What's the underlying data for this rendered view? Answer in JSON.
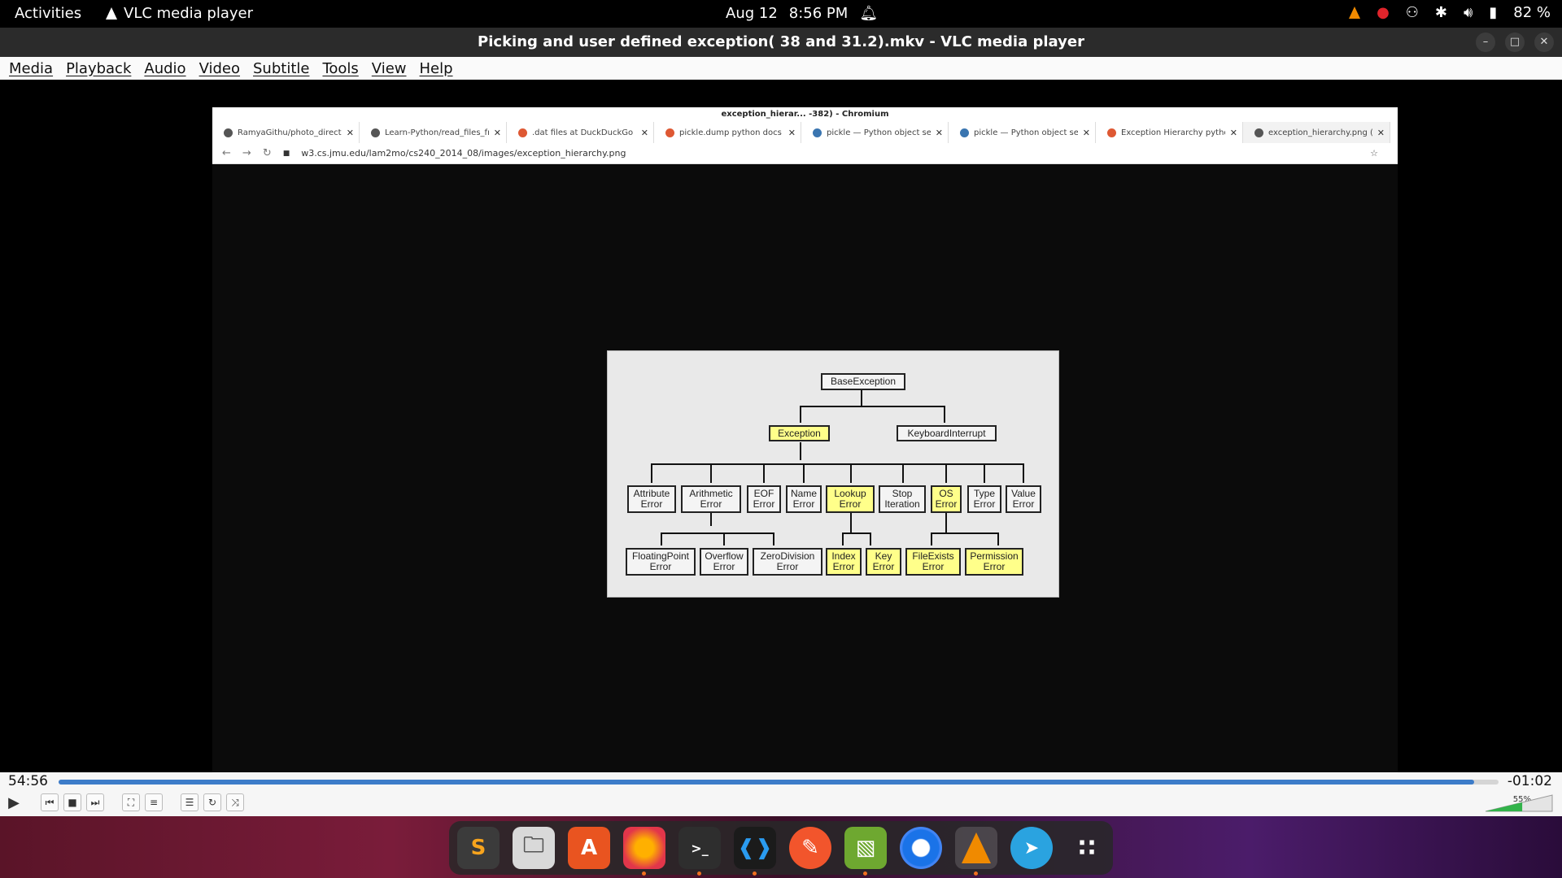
{
  "topbar": {
    "activities": "Activities",
    "app_name": "VLC media player",
    "date": "Aug 12",
    "time": "8:56 PM",
    "battery": "82 %"
  },
  "window": {
    "title": "Picking and user defined exception( 38 and 31.2).mkv - VLC media player"
  },
  "menu": [
    "Media",
    "Playback",
    "Audio",
    "Video",
    "Subtitle",
    "Tools",
    "View",
    "Help"
  ],
  "browser": {
    "window_title": "exception_hierar... -382) - Chromium",
    "tabs": [
      {
        "title": "RamyaGithu/photo_directo",
        "icon": "github-icon"
      },
      {
        "title": "Learn-Python/read_files_fr",
        "icon": "github-icon"
      },
      {
        "title": ".dat files at DuckDuckGo",
        "icon": "duckduckgo-icon"
      },
      {
        "title": "pickle.dump python docs at",
        "icon": "duckduckgo-icon"
      },
      {
        "title": "pickle — Python object seri",
        "icon": "python-icon"
      },
      {
        "title": "pickle — Python object seri",
        "icon": "python-icon"
      },
      {
        "title": "Exception Hierarchy python",
        "icon": "duckduckgo-icon"
      },
      {
        "title": "exception_hierarchy.png (7",
        "icon": "globe-icon"
      }
    ],
    "url": "w3.cs.jmu.edu/lam2mo/cs240_2014_08/images/exception_hierarchy.png"
  },
  "diagram": {
    "root": "BaseException",
    "level1": [
      "Exception",
      "KeyboardInterrupt"
    ],
    "level2": [
      "Attribute\nError",
      "Arithmetic\nError",
      "EOF\nError",
      "Name\nError",
      "Lookup\nError",
      "Stop\nIteration",
      "OS\nError",
      "Type\nError",
      "Value\nError"
    ],
    "level3": [
      "FloatingPoint\nError",
      "Overflow\nError",
      "ZeroDivision\nError",
      "Index\nError",
      "Key\nError",
      "FileExists\nError",
      "Permission\nError"
    ],
    "highlight_color": "#ffff8a"
  },
  "player": {
    "elapsed": "54:56",
    "remaining": "-01:02",
    "progress_fraction": 0.983,
    "volume": "55%"
  },
  "dock": [
    "sublime-text-icon",
    "files-icon",
    "app-center-icon",
    "firefox-icon",
    "terminal-icon",
    "vscode-icon",
    "pen-app-icon",
    "image-viewer-icon",
    "chromium-icon",
    "vlc-icon",
    "telegram-icon",
    "app-grid-icon"
  ]
}
